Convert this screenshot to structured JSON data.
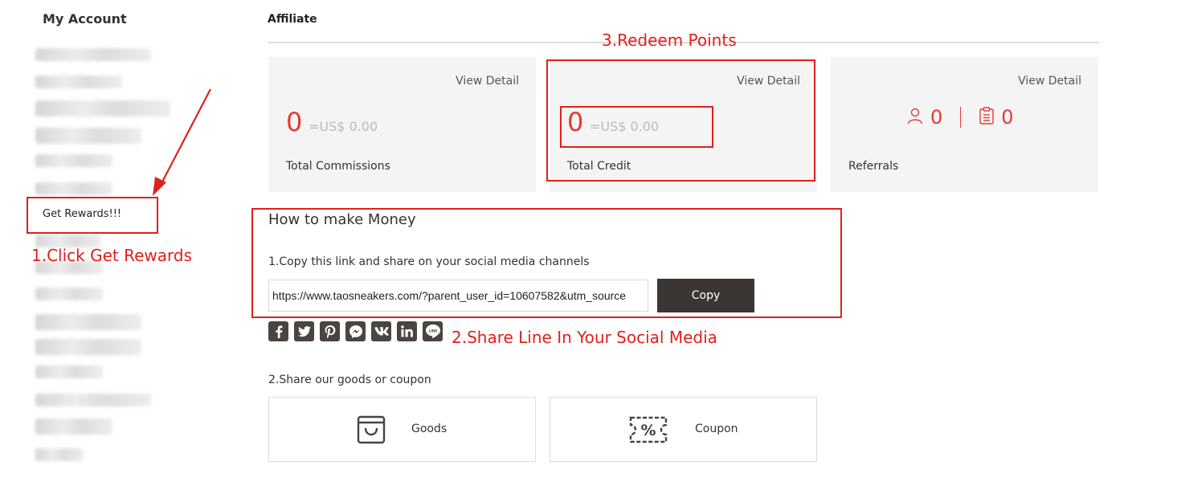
{
  "sidebar": {
    "title": "My Account",
    "highlight_item": "Get Rewards!!!"
  },
  "affiliate": {
    "title": "Affiliate",
    "cards": [
      {
        "view_label": "View Detail",
        "value": "0",
        "usd": "=US$ 0.00",
        "label": "Total Commissions"
      },
      {
        "view_label": "View Detail",
        "value": "0",
        "usd": "=US$ 0.00",
        "label": "Total Credit"
      },
      {
        "view_label": "View Detail",
        "label": "Referrals",
        "people_count": "0",
        "order_count": "0"
      }
    ]
  },
  "how_to": {
    "title": "How to make Money",
    "step1": "1.Copy this link and share on your social media channels",
    "link_value": "https://www.taosneakers.com/?parent_user_id=10607582&utm_source",
    "copy_label": "Copy",
    "social_icons": [
      "facebook-icon",
      "twitter-icon",
      "pinterest-icon",
      "messenger-icon",
      "vk-icon",
      "linkedin-icon",
      "line-icon"
    ],
    "step2": "2.Share our goods or coupon",
    "goods_label": "Goods",
    "coupon_label": "Coupon"
  },
  "annotations": {
    "click_rewards": "1.Click Get Rewards",
    "share_line": "2.Share Line In Your Social Media",
    "redeem": "3.Redeem Points"
  },
  "colors": {
    "accent_red": "#e53935",
    "annotation_red": "#e0201a",
    "button_dark": "#3b3634",
    "card_bg": "#f4f4f4"
  }
}
